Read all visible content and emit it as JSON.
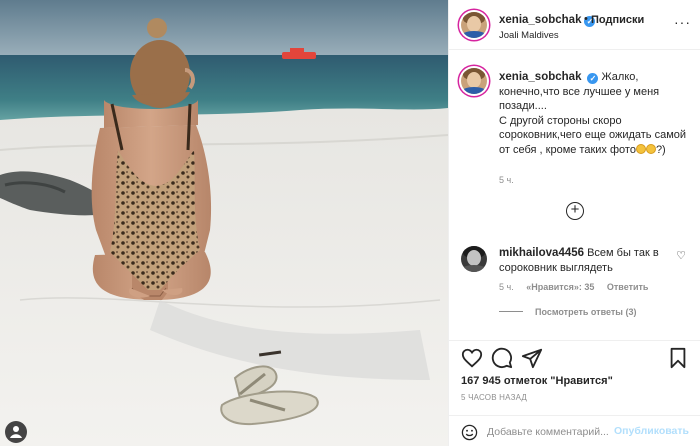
{
  "post": {
    "image_alt": "beach photo",
    "author": {
      "username": "xenia_sobchak",
      "verified_icon": "verified-badge-icon",
      "location": "Joali Maldives"
    },
    "header": {
      "dot": "•",
      "follow_label": "Подписки",
      "more_icon": "more-horizontal-icon",
      "more_glyph": "···"
    },
    "caption": {
      "username": "xenia_sobchak",
      "text_line1": "Жалко, конечно,что все лучшее у меня позади....",
      "text_line2": "С другой стороны скоро сороковник,чего еще ожидать самой от себя , кроме таких фото",
      "text_end": "?)",
      "time": "5 ч."
    },
    "load_more_glyph": "+",
    "comment": {
      "username": "mikhailova4456",
      "text": "Всем бы так в сороковник выглядеть",
      "time": "5 ч.",
      "likes": "«Нравится»: 35",
      "reply_label": "Ответить",
      "heart_glyph": "♡",
      "view_replies": "Посмотреть ответы (3)"
    },
    "actions": {
      "likes_count": "167 945 отметок \"Нравится\"",
      "post_time": "5 ЧАСОВ НАЗАД"
    },
    "add_comment": {
      "placeholder": "Добавьте комментарий...",
      "publish_label": "Опубликовать"
    }
  }
}
